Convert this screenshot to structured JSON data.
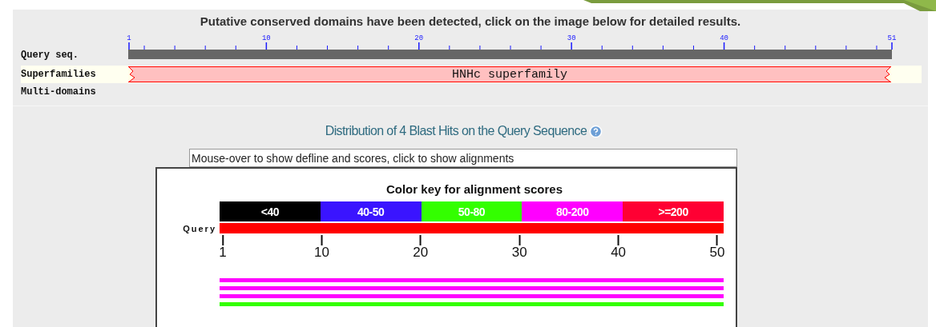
{
  "summary": {
    "title": "Putative conserved domains have been detected, click on the image below for detailed results.",
    "ruler_ticks": [
      "1",
      "10",
      "20",
      "30",
      "40",
      "51"
    ],
    "tracks": [
      {
        "label": "Query seq.",
        "kind": "ruler"
      },
      {
        "label": "Superfamilies",
        "kind": "domains",
        "domains": [
          {
            "label": "HNHc superfamily"
          }
        ]
      },
      {
        "label": "Multi-domains",
        "kind": "empty"
      }
    ]
  },
  "hits": {
    "title": "Distribution of 4 Blast Hits on the Query Sequence",
    "info_field": {
      "value": "Mouse-over to show defline and scores, click to show alignments"
    },
    "color_key": {
      "title": "Color key for alignment scores",
      "ranges": [
        {
          "label": "<40",
          "color": "#000000"
        },
        {
          "label": "40-50",
          "color": "#3a14ff"
        },
        {
          "label": "50-80",
          "color": "#33ff00"
        },
        {
          "label": "80-200",
          "color": "#ff00ff"
        },
        {
          "label": ">=200",
          "color": "#ff0033"
        }
      ]
    },
    "query_label": "Query",
    "axis_ticks": [
      "1",
      "10",
      "20",
      "30",
      "40",
      "50"
    ],
    "alignments": [
      {
        "color": "#ff00ff"
      },
      {
        "color": "#ff00ff"
      },
      {
        "color": "#ff00ff"
      },
      {
        "color": "#33ff00"
      }
    ]
  }
}
